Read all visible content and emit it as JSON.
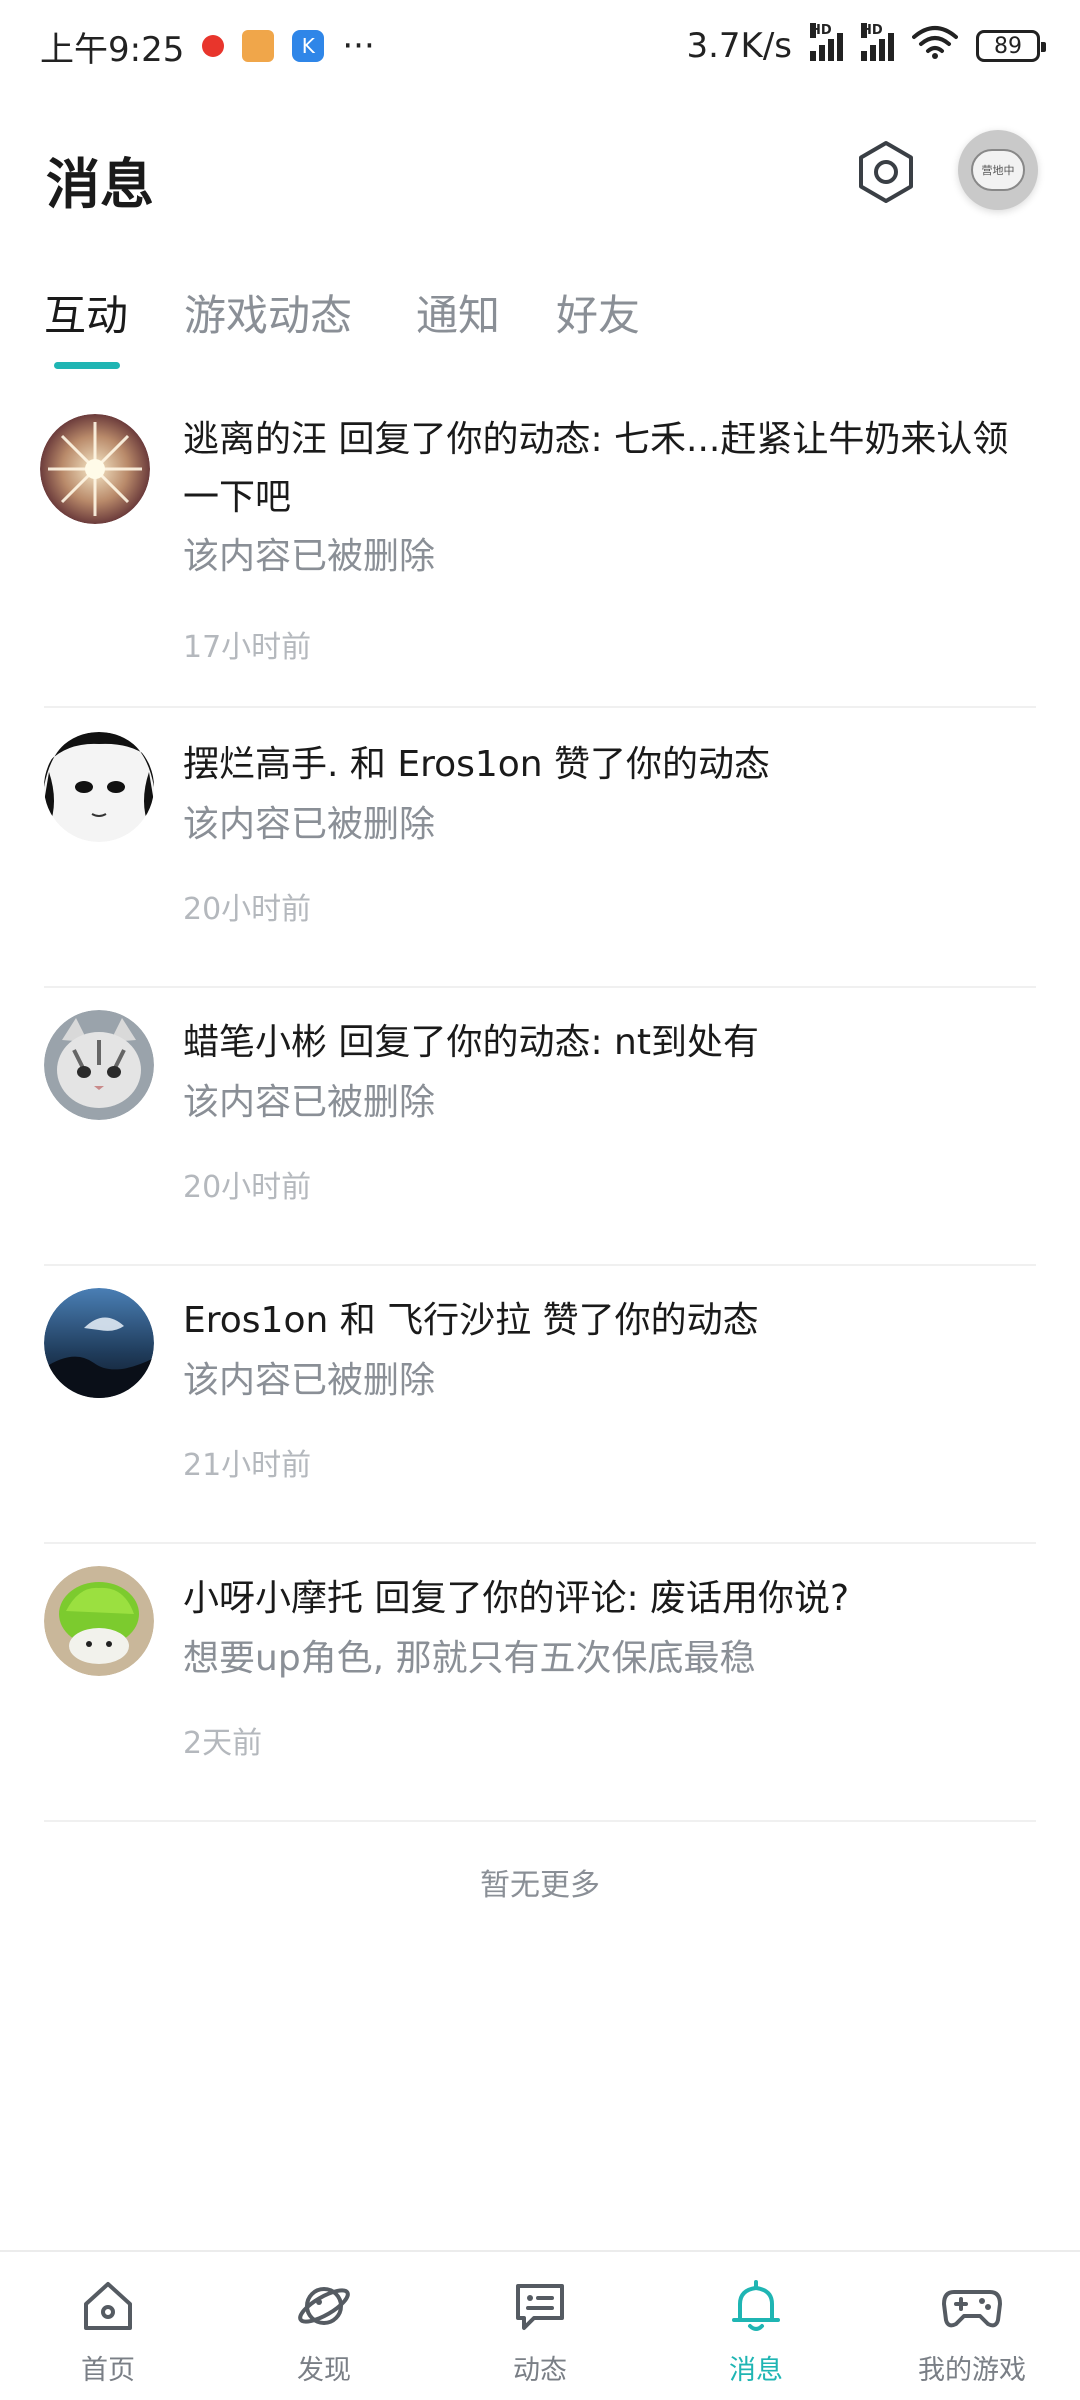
{
  "status_bar": {
    "time": "上午9:25",
    "ellipsis": "···",
    "net_speed": "3.7K/s",
    "signal_tag": "HD",
    "battery": "89"
  },
  "header": {
    "title": "消息",
    "avatar_text": "营地中"
  },
  "tabs": [
    {
      "label": "互动",
      "active": true
    },
    {
      "label": "游戏动态",
      "active": false
    },
    {
      "label": "通知",
      "active": false
    },
    {
      "label": "好友",
      "active": false
    }
  ],
  "messages": [
    {
      "title": "逃离的汪 回复了你的动态: 七禾...赶紧让牛奶来认领一下吧",
      "subtitle": "该内容已被删除",
      "time": "17小时前"
    },
    {
      "title": "摆烂高手. 和 Eros1on 赞了你的动态",
      "subtitle": "该内容已被删除",
      "time": "20小时前"
    },
    {
      "title": "蜡笔小彬 回复了你的动态: nt到处有",
      "subtitle": "该内容已被删除",
      "time": "20小时前"
    },
    {
      "title": "Eros1on 和 飞行沙拉 赞了你的动态",
      "subtitle": "该内容已被删除",
      "time": "21小时前"
    },
    {
      "title": "小呀小摩托 回复了你的评论: 废话用你说?",
      "subtitle": "想要up角色, 那就只有五次保底最稳",
      "time": "2天前"
    }
  ],
  "no_more": "暂无更多",
  "bottom_nav": [
    {
      "label": "首页",
      "icon": "home-icon",
      "active": false
    },
    {
      "label": "发现",
      "icon": "planet-icon",
      "active": false
    },
    {
      "label": "动态",
      "icon": "chat-icon",
      "active": false
    },
    {
      "label": "消息",
      "icon": "bell-icon",
      "active": true
    },
    {
      "label": "我的游戏",
      "icon": "gamepad-icon",
      "active": false
    }
  ],
  "colors": {
    "accent": "#1fb5b3",
    "text_primary": "#1a1a1a",
    "text_secondary": "#8a8f96",
    "text_tertiary": "#b4b8bd"
  }
}
